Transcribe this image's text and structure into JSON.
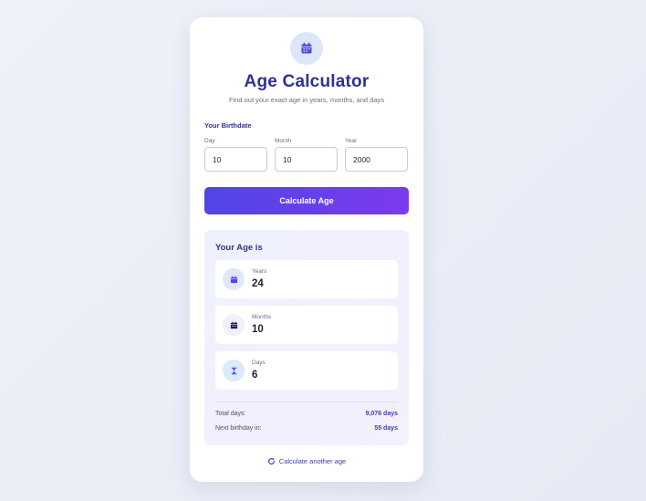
{
  "app": {
    "title": "Age Calculator",
    "subtitle": "Find out your exact age in years, months, and days",
    "logo_icon": "calendar-icon"
  },
  "form": {
    "section_label": "Your Birthdate",
    "day": {
      "label": "Day",
      "value": "10"
    },
    "month": {
      "label": "Month",
      "value": "10"
    },
    "year": {
      "label": "Year",
      "value": "2000"
    },
    "submit_label": "Calculate Age"
  },
  "result": {
    "title": "Your Age is",
    "stats": [
      {
        "label": "Years",
        "value": "24",
        "icon": "calendar-icon",
        "icon_bg": "#e0e7fb",
        "icon_color": "#4f46e5"
      },
      {
        "label": "Months",
        "value": "10",
        "icon": "calendar-icon",
        "icon_bg": "#f1effa",
        "icon_color": "#1e1b4b"
      },
      {
        "label": "Days",
        "value": "6",
        "icon": "hourglass-icon",
        "icon_bg": "#dbeafe",
        "icon_color": "#4f46e5"
      }
    ],
    "total_days": {
      "label": "Total days:",
      "value": "9,076 days"
    },
    "next_birthday": {
      "label": "Next birthday in:",
      "value": "55 days"
    }
  },
  "reset": {
    "label": "Calculate another age",
    "icon": "refresh-icon"
  },
  "colors": {
    "accent": "#2f3192",
    "button_gradient_start": "#4f46e5",
    "button_gradient_end": "#7c3aed",
    "link": "#3b3fb0"
  }
}
